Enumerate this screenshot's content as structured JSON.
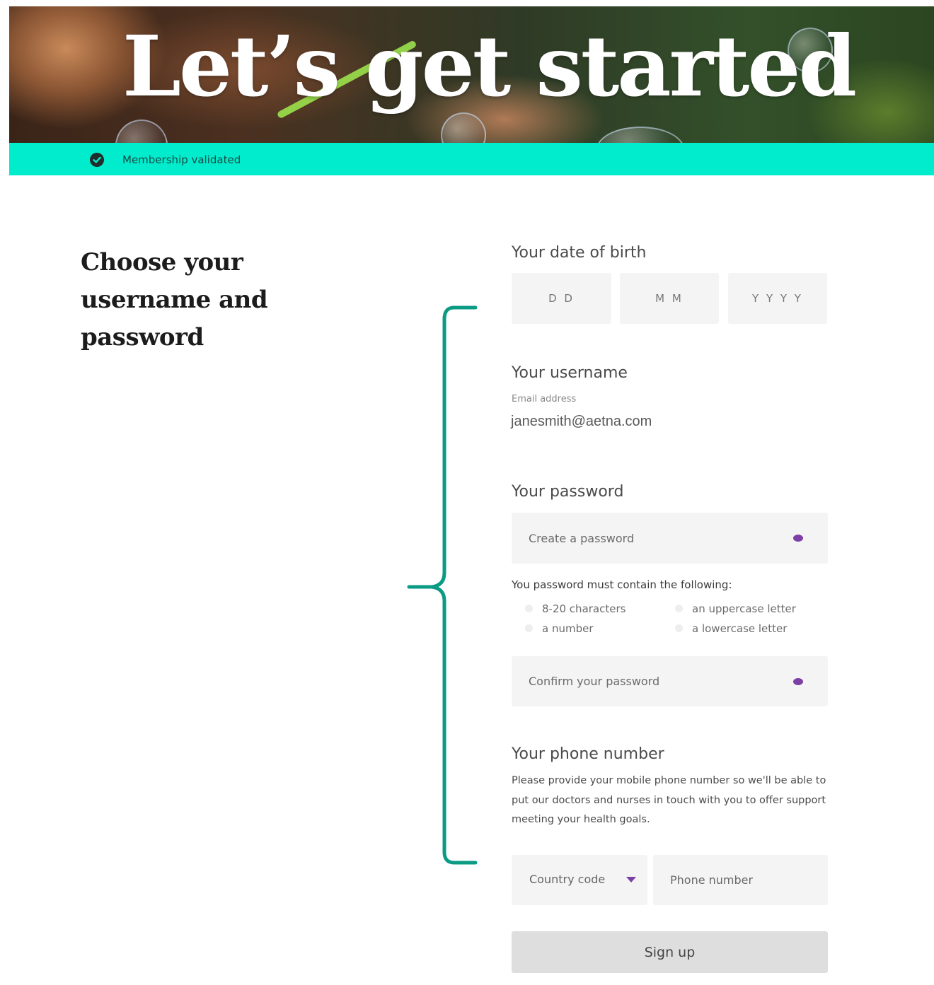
{
  "hero": {
    "title": "Let’s get started"
  },
  "banner": {
    "text": "Membership validated"
  },
  "heading": {
    "line1": "Choose your",
    "line2": "username and",
    "line3": "password"
  },
  "dob": {
    "label": "Your date of birth",
    "day_placeholder": "D D",
    "month_placeholder": "M M",
    "year_placeholder": "Y Y Y Y"
  },
  "username": {
    "label": "Your username",
    "email_label": "Email address",
    "email_value": "janesmith@aetna.com"
  },
  "password": {
    "label": "Your password",
    "create_placeholder": "Create a password",
    "requirements_title": "You password must contain the following:",
    "requirements": [
      "8-20 characters",
      "an uppercase letter",
      "a number",
      "a lowercase letter"
    ],
    "confirm_placeholder": "Confirm your password"
  },
  "phone": {
    "label": "Your phone number",
    "description": "Please provide your mobile phone number so we'll be able to put our doctors and nurses in touch with you to offer support meeting your health goals.",
    "country_label": "Country code",
    "number_placeholder": "Phone number"
  },
  "signup": {
    "label": "Sign up"
  },
  "colors": {
    "accent": "#00eccd",
    "icon": "#7b3fa6",
    "bracket": "#0b9b85"
  }
}
